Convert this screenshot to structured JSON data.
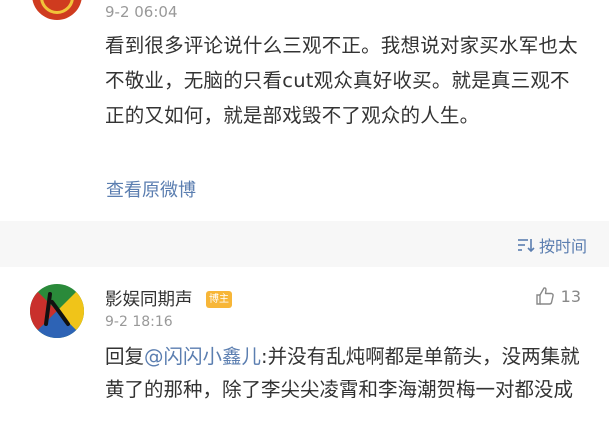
{
  "post": {
    "time": "9-2 06:04",
    "text": "看到很多评论说什么三观不正。我想说对家买水军也太不敬业，无脑的只看cut观众真好收买。就是真三观不正的又如何，就是部戏毁不了观众的人生。",
    "view_original": "查看原微博"
  },
  "sort": {
    "label": "按时间",
    "icon": "sort-icon"
  },
  "comment": {
    "author": "影娱同期声",
    "badge": "博主",
    "time": "9-2 18:16",
    "likes": "13",
    "reply_prefix": "回复",
    "mention": "@闪闪小鑫儿",
    "text": ":并没有乱炖啊都是单箭头，没两集就黄了的那种，除了李尖尖凌霄和李海潮贺梅一对都没成"
  },
  "colors": {
    "link": "#5b7eb0",
    "badge": "#f7b638",
    "band": "#f7f7f7"
  }
}
